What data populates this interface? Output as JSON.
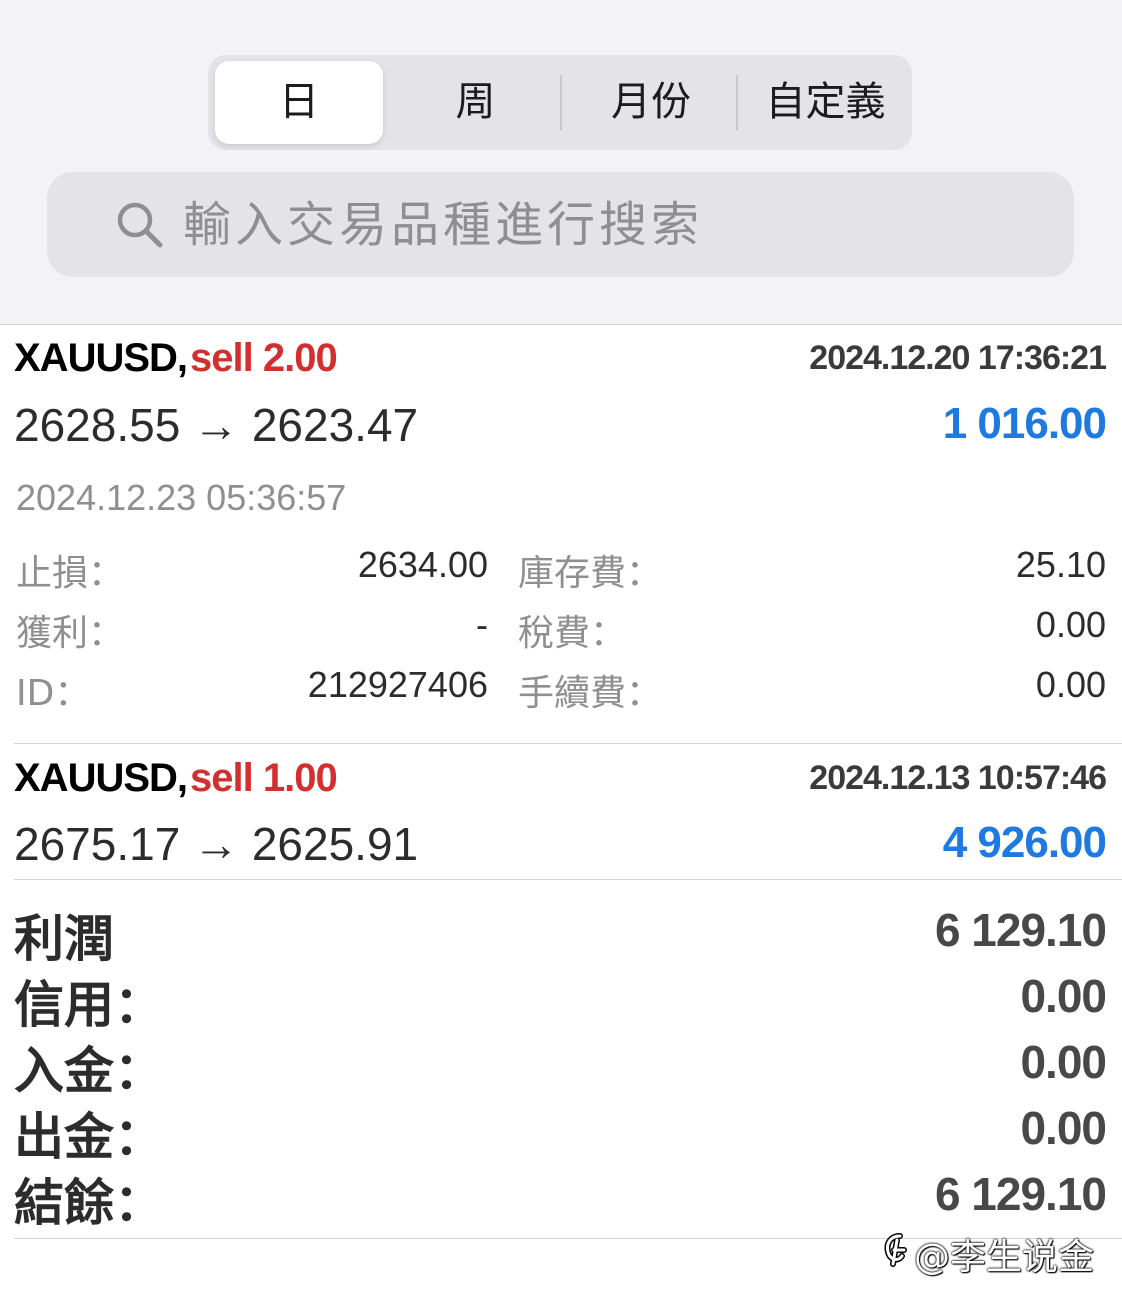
{
  "tabs": [
    {
      "label": "日",
      "active": true
    },
    {
      "label": "周",
      "active": false
    },
    {
      "label": "月份",
      "active": false
    },
    {
      "label": "自定義",
      "active": false
    }
  ],
  "search": {
    "placeholder": "輸入交易品種進行搜索",
    "icon": "search-icon"
  },
  "trades": [
    {
      "symbol": "XAUUSD,",
      "side": "sell 2.00",
      "open_time": "2024.12.20 17:36:21",
      "prices": "2628.55 → 2623.47",
      "profit": "1 016.00",
      "close_time": "2024.12.23 05:36:57",
      "details": {
        "sl_label": "止損：",
        "sl_value": "2634.00",
        "swap_label": "庫存費：",
        "swap_value": "25.10",
        "tp_label": "獲利：",
        "tp_value": "-",
        "tax_label": "稅費：",
        "tax_value": "0.00",
        "id_label": "ID：",
        "id_value": "212927406",
        "commission_label": "手續費：",
        "commission_value": "0.00"
      }
    },
    {
      "symbol": "XAUUSD,",
      "side": "sell 1.00",
      "open_time": "2024.12.13 10:57:46",
      "prices": "2675.17 → 2625.91",
      "profit": "4 926.00"
    }
  ],
  "summary": [
    {
      "label": "利潤",
      "value": "6 129.10"
    },
    {
      "label": "信用：",
      "value": "0.00"
    },
    {
      "label": "入金：",
      "value": "0.00"
    },
    {
      "label": "出金：",
      "value": "0.00"
    },
    {
      "label": "結餘：",
      "value": "6 129.10"
    }
  ],
  "watermark": "@李生说金",
  "colors": {
    "sell": "#d32f2f",
    "profit": "#1e7ae0",
    "background": "#f2f2f7"
  }
}
